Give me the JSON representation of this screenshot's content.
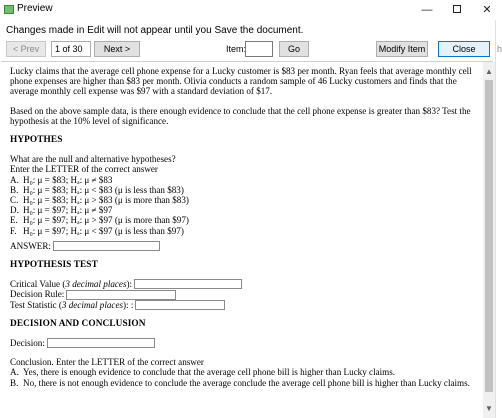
{
  "window": {
    "title": "Preview",
    "minimize_glyph": "—",
    "close_glyph": "✕"
  },
  "notice": "Changes made in Edit will not appear until you Save the document.",
  "toolbar": {
    "prev_label": "< Prev",
    "page_of": "1 of 30",
    "next_label": "Next >",
    "item_label": "Item:",
    "item_value": "",
    "go_label": "Go",
    "modify_label": "Modify Item",
    "close_label": "Close"
  },
  "problem": {
    "intro": "Lucky claims that the average cell phone expense for a Lucky customer is $83 per month.  Ryan feels that average monthly cell phone expenses are higher than $83 per month.  Olivia conducts a random sample of 46 Lucky customers and finds that the average monthly cell expense was $97 with a standard deviation of $17.",
    "question": "Based on the above sample data, is there enough evidence to conclude that the cell phone expense is greater than $83? Test the hypothesis at the 10% level of significance."
  },
  "hypotheses": {
    "heading": "HYPOTHES",
    "prompt1": "What are the null and alternative hypotheses?",
    "prompt2": "Enter the LETTER of the correct answer",
    "options": [
      {
        "letter": "A.",
        "text": "H₀: μ = $83;  Hₐ: μ ≠ $83"
      },
      {
        "letter": "B.",
        "text": "H₀: μ = $83;  Hₐ: μ < $83 (μ is less than $83)"
      },
      {
        "letter": "C.",
        "text": "H₀: μ = $83;  Hₐ: μ > $83 (μ is more than $83)"
      },
      {
        "letter": "D.",
        "text": "H₀: μ = $97;  Hₐ: μ ≠ $97"
      },
      {
        "letter": "E.",
        "text": "H₀: μ = $97;  Hₐ: μ > $97 (μ is more than $97)"
      },
      {
        "letter": "F.",
        "text": "H₀: μ = $97;  Hₐ: μ < $97 (μ is less than $97)"
      }
    ],
    "answer_label": "ANSWER:",
    "answer_value": ""
  },
  "test": {
    "heading": "HYPOTHESIS TEST",
    "critical_label": "Critical Value (",
    "critical_hint": "3 decimal places",
    "critical_suffix": "):",
    "critical_value": "",
    "rule_label": "Decision Rule:",
    "rule_value": "",
    "stat_label": "Test Statistic (",
    "stat_hint": "3 decimal places",
    "stat_suffix": "):  :",
    "stat_value": ""
  },
  "decision": {
    "heading": "DECISION AND CONCLUSION",
    "decision_label": "Decision:",
    "decision_value": "",
    "conclusion_prompt": "Conclusion.   Enter the LETTER of the correct answer",
    "options": [
      {
        "letter": "A.",
        "text": "Yes, there is enough evidence to conclude that the average cell phone bill is higher than Lucky claims."
      },
      {
        "letter": "B.",
        "text": "No, there is not enough evidence to conclude the average conclude the average cell phone bill is higher than Lucky claims."
      }
    ]
  },
  "scrollbar": {
    "up_glyph": "▲",
    "down_glyph": "▼"
  },
  "right_edge_peek": "h"
}
